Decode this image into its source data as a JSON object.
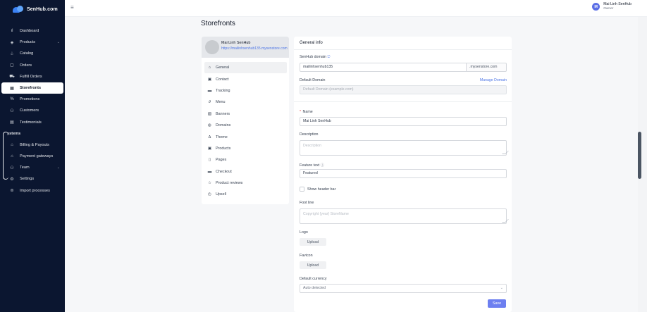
{
  "app": {
    "logo_text": "SenHub.com"
  },
  "sidebar": {
    "items": [
      {
        "label": "Dashboard",
        "icon": "bar-chart-icon",
        "glyph": "ıl"
      },
      {
        "label": "Products",
        "icon": "box-icon",
        "glyph": "◈",
        "has_children": true
      },
      {
        "label": "Catalog",
        "icon": "catalog-icon",
        "glyph": "♧"
      },
      {
        "label": "Orders",
        "icon": "orders-icon",
        "glyph": "▢"
      },
      {
        "label": "Fulfill Orders",
        "icon": "truck-icon",
        "glyph": "⛟"
      },
      {
        "label": "Storefronts",
        "icon": "storefront-icon",
        "glyph": "▦",
        "active": true
      },
      {
        "label": "Promotions",
        "icon": "percent-icon",
        "glyph": "%"
      },
      {
        "label": "Customers",
        "icon": "customers-icon",
        "glyph": "⚇"
      },
      {
        "label": "Testimonials",
        "icon": "testimonials-icon",
        "glyph": "▤"
      }
    ],
    "section_label": "ystems",
    "system_items": [
      {
        "label": "Billing & Payouts",
        "icon": "bank-icon",
        "glyph": "⌂"
      },
      {
        "label": "Payment gateways",
        "icon": "bank-icon",
        "glyph": "⌂"
      },
      {
        "label": "Team",
        "icon": "team-icon",
        "glyph": "⚇",
        "has_children": true
      },
      {
        "label": "Settings",
        "icon": "settings-icon",
        "glyph": "⚙"
      },
      {
        "label": "Import processes",
        "icon": "import-icon",
        "glyph": "⊜"
      }
    ]
  },
  "header": {
    "user_initial": "M",
    "user_name": "Mai Linh SenHub",
    "user_role": "Owner"
  },
  "page": {
    "title": "Storefronts"
  },
  "store": {
    "name": "Mai Linh SenHub",
    "url": "https://mailinhsenhub135.mysenstore.com"
  },
  "store_menu": [
    {
      "label": "General",
      "icon": "home-icon",
      "glyph": "⌂",
      "active": true
    },
    {
      "label": "Contact",
      "icon": "contact-icon",
      "glyph": "▣"
    },
    {
      "label": "Tracking",
      "icon": "tracking-icon",
      "glyph": "▬"
    },
    {
      "label": "Menu",
      "icon": "link-icon",
      "glyph": "∂"
    },
    {
      "label": "Banners",
      "icon": "banner-icon",
      "glyph": "▧"
    },
    {
      "label": "Domains",
      "icon": "globe-icon",
      "glyph": "◍"
    },
    {
      "label": "Theme",
      "icon": "theme-icon",
      "glyph": "Δ"
    },
    {
      "label": "Products",
      "icon": "products-icon",
      "glyph": "▣"
    },
    {
      "label": "Pages",
      "icon": "pages-icon",
      "glyph": "▯"
    },
    {
      "label": "Checkout",
      "icon": "checkout-icon",
      "glyph": "▬"
    },
    {
      "label": "Product reviews",
      "icon": "star-icon",
      "glyph": "☆"
    },
    {
      "label": "Upsell",
      "icon": "upsell-icon",
      "glyph": "◴"
    }
  ],
  "form": {
    "section_title": "General info",
    "senhub_domain_label": "SenHub domain",
    "senhub_domain_value": "mailinhsenhub135",
    "senhub_domain_suffix": ".mysenstore.com",
    "default_domain_label": "Default Domain",
    "manage_domain_link": "Manage Domain",
    "default_domain_placeholder": "Default Domain (example.com)",
    "name_label": "Name",
    "name_value": "Mai Linh SenHub",
    "description_label": "Description",
    "description_placeholder": "Description",
    "feature_text_label": "Feature text",
    "feature_text_value": "Featured",
    "show_header_bar_label": "Show header bar",
    "foot_line_label": "Foot line",
    "foot_line_placeholder": "Copyright {year} StoreName",
    "logo_label": "Logo",
    "logo_upload": "Upload",
    "favicon_label": "Favicon",
    "favicon_upload": "Upload",
    "default_currency_label": "Default currency",
    "default_currency_value": "Auto detected",
    "save_label": "Save"
  }
}
